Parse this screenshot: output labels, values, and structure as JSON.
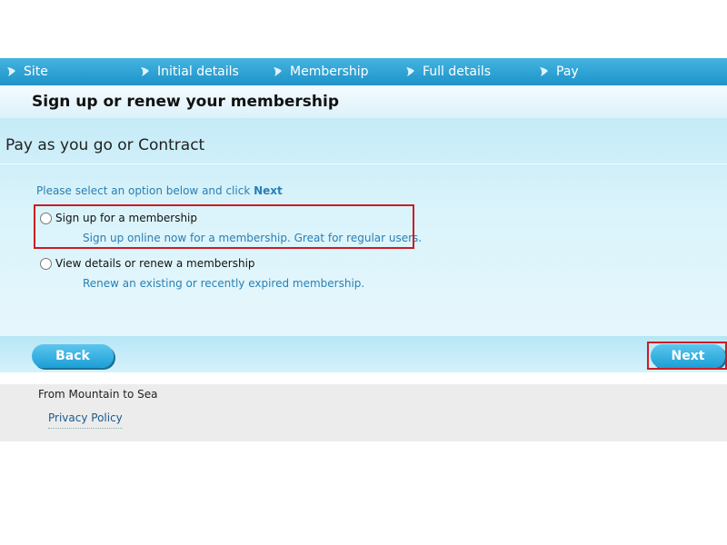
{
  "nav": {
    "items": [
      {
        "label": "Site"
      },
      {
        "label": "Initial details"
      },
      {
        "label": "Membership"
      },
      {
        "label": "Full details"
      },
      {
        "label": "Pay"
      }
    ]
  },
  "header": {
    "title": "Sign up or renew your membership"
  },
  "main": {
    "section_title": "Pay as you go or Contract",
    "instruction_prefix": "Please select an option below and click ",
    "instruction_bold": "Next",
    "options": [
      {
        "label": "Sign up for a membership",
        "description": "Sign up online now for a membership. Great for regular users."
      },
      {
        "label": "View details or renew a membership",
        "description": "Renew an existing or recently expired membership."
      }
    ]
  },
  "actions": {
    "back_label": "Back",
    "next_label": "Next"
  },
  "footer": {
    "tagline": "From Mountain to Sea",
    "privacy_label": "Privacy Policy"
  },
  "colors": {
    "nav": "#1e93c9",
    "accent": "#2a7fb3",
    "highlight": "#cc1c24"
  }
}
